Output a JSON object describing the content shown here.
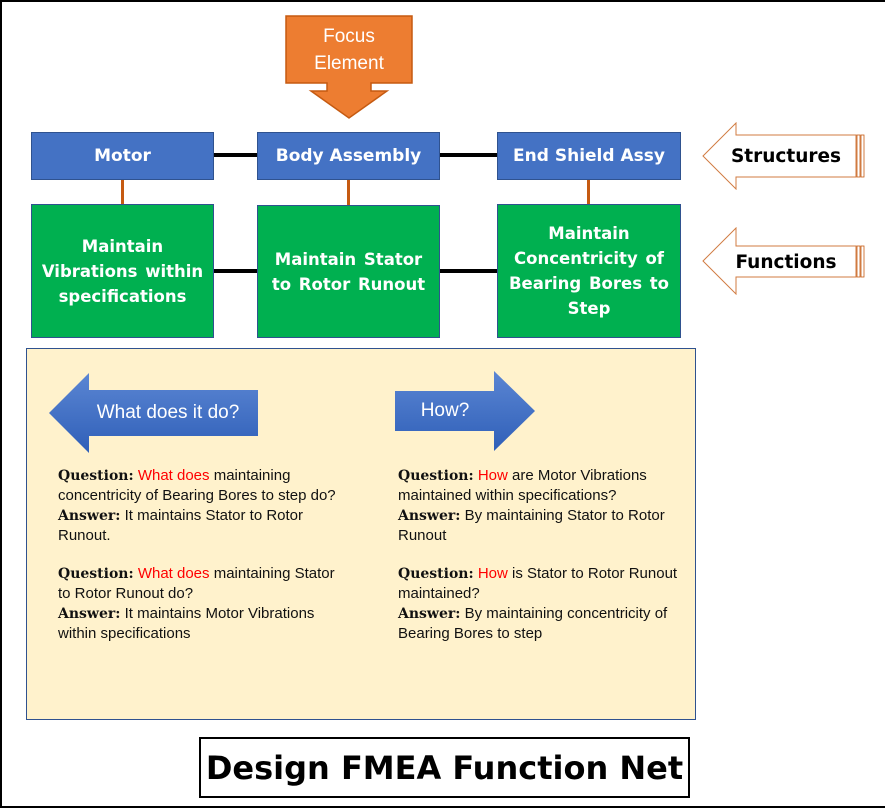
{
  "colors": {
    "structure_fill": "#4472c4",
    "function_fill": "#00b050",
    "focus_fill": "#ed7d31",
    "panel_fill": "#fff2cc",
    "connector_horizontal": "#000000",
    "connector_vertical": "#c55a11",
    "highlight_text": "#ff0000"
  },
  "focus": {
    "line1": "Focus",
    "line2": "Element"
  },
  "structures": [
    {
      "label": "Motor"
    },
    {
      "label": "Body Assembly"
    },
    {
      "label": "End Shield Assy"
    }
  ],
  "functions": [
    {
      "label": "Maintain Vibrations within specifications"
    },
    {
      "label": "Maintain Stator to Rotor Runout"
    },
    {
      "label": "Maintain Concentricity of Bearing Bores to Step"
    }
  ],
  "side_labels": {
    "structures": "Structures",
    "functions": "Functions"
  },
  "panel": {
    "left_arrow": "What does it do?",
    "right_arrow": "How?",
    "left_qa": [
      {
        "q_label": "Question:",
        "q_highlight": "What does",
        "q_rest": " maintaining concentricity of Bearing Bores to step  do?",
        "a_label": "Answer:",
        "a_text": " It maintains Stator to Rotor Runout."
      },
      {
        "q_label": "Question:",
        "q_highlight": "What does",
        "q_rest": " maintaining Stator to Rotor Runout do?",
        "a_label": "Answer:",
        "a_text": " It maintains Motor Vibrations within specifications"
      }
    ],
    "right_qa": [
      {
        "q_label": "Question:",
        "q_highlight": "How",
        "q_rest": " are Motor Vibrations maintained within specifications?",
        "a_label": "Answer:",
        "a_text": " By maintaining Stator to Rotor Runout"
      },
      {
        "q_label": "Question:",
        "q_highlight": "How",
        "q_rest": " is Stator to Rotor Runout maintained?",
        "a_label": "Answer:",
        "a_text": " By maintaining concentricity of Bearing Bores to step"
      }
    ]
  },
  "title": "Design FMEA Function Net"
}
